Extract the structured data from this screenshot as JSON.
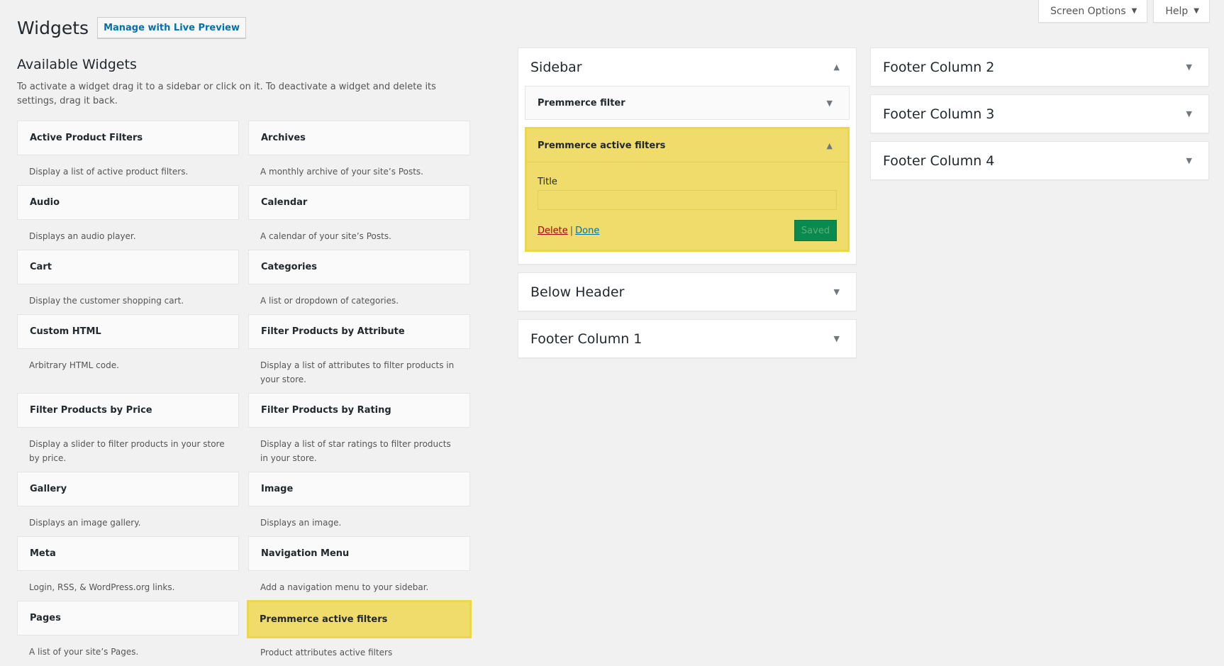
{
  "screen_meta": {
    "screen_options": "Screen Options",
    "help": "Help"
  },
  "header": {
    "title": "Widgets",
    "live_preview": "Manage with Live Preview"
  },
  "available": {
    "title": "Available Widgets",
    "description": "To activate a widget drag it to a sidebar or click on it. To deactivate a widget and delete its settings, drag it back.",
    "widgets": [
      {
        "name": "Active Product Filters",
        "desc": "Display a list of active product filters."
      },
      {
        "name": "Archives",
        "desc": "A monthly archive of your site’s Posts."
      },
      {
        "name": "Audio",
        "desc": "Displays an audio player."
      },
      {
        "name": "Calendar",
        "desc": "A calendar of your site’s Posts."
      },
      {
        "name": "Cart",
        "desc": "Display the customer shopping cart."
      },
      {
        "name": "Categories",
        "desc": "A list or dropdown of categories."
      },
      {
        "name": "Custom HTML",
        "desc": "Arbitrary HTML code."
      },
      {
        "name": "Filter Products by Attribute",
        "desc": "Display a list of attributes to filter products in your store."
      },
      {
        "name": "Filter Products by Price",
        "desc": "Display a slider to filter products in your store by price."
      },
      {
        "name": "Filter Products by Rating",
        "desc": "Display a list of star ratings to filter products in your store."
      },
      {
        "name": "Gallery",
        "desc": "Displays an image gallery."
      },
      {
        "name": "Image",
        "desc": "Displays an image."
      },
      {
        "name": "Meta",
        "desc": "Login, RSS, & WordPress.org links."
      },
      {
        "name": "Navigation Menu",
        "desc": "Add a navigation menu to your sidebar."
      },
      {
        "name": "Pages",
        "desc": "A list of your site’s Pages."
      },
      {
        "name": "Premmerce active filters",
        "desc": "Product attributes active filters"
      }
    ]
  },
  "sidebar": {
    "title": "Sidebar",
    "widget1": "Premmerce filter",
    "widget2": {
      "name": "Premmerce active filters",
      "field_label": "Title",
      "field_value": "",
      "delete": "Delete",
      "separator": "|",
      "done": "Done",
      "saved": "Saved"
    }
  },
  "areas": {
    "below_header": "Below Header",
    "footer1": "Footer Column 1",
    "footer2": "Footer Column 2",
    "footer3": "Footer Column 3",
    "footer4": "Footer Column 4"
  },
  "colors": {
    "highlight": "#f0dc6a",
    "link": "#0073aa",
    "saved_button": "#0a8a4e"
  }
}
